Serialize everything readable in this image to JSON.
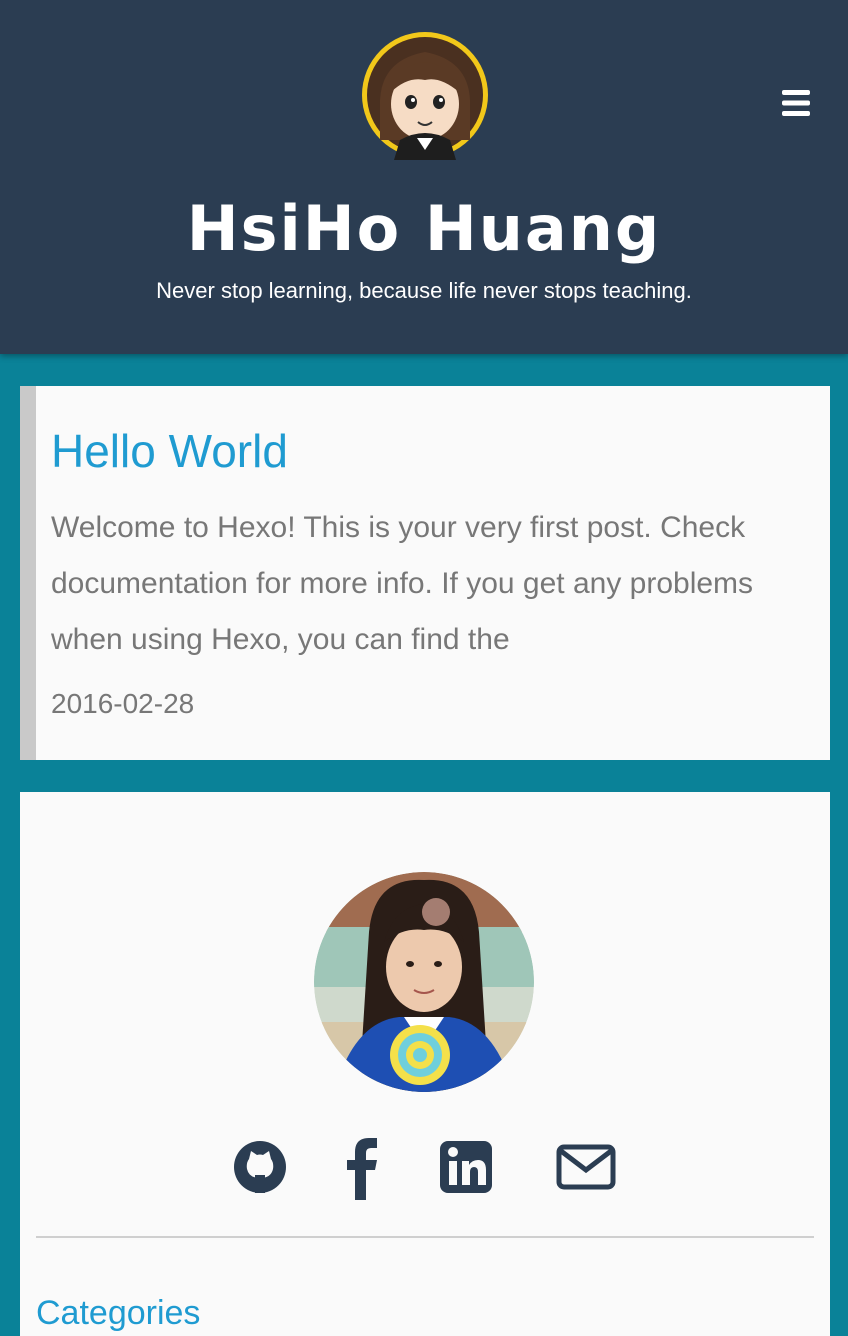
{
  "header": {
    "title": "HsiHo Huang",
    "subtitle": "Never stop learning, because life never stops teaching.",
    "menu_icon": "bars-icon",
    "logo": "cartoon-avatar-logo"
  },
  "posts": [
    {
      "title": "Hello World",
      "excerpt": "Welcome to Hexo! This is your very first post. Check documentation for more info. If you get any problems when using Hexo, you can find the",
      "date": "2016-02-28"
    }
  ],
  "sidebar": {
    "avatar": "profile-photo",
    "social": [
      {
        "icon": "github-icon"
      },
      {
        "icon": "facebook-icon"
      },
      {
        "icon": "linkedin-icon"
      },
      {
        "icon": "envelope-icon"
      }
    ],
    "categories_title": "Categories"
  },
  "colors": {
    "page_background": "#0a8298",
    "header_background": "#2b3d52",
    "link": "#1f9bd1",
    "card_background": "#fafafa",
    "card_accent": "#c9c9c9",
    "icon": "#2b3d52"
  }
}
